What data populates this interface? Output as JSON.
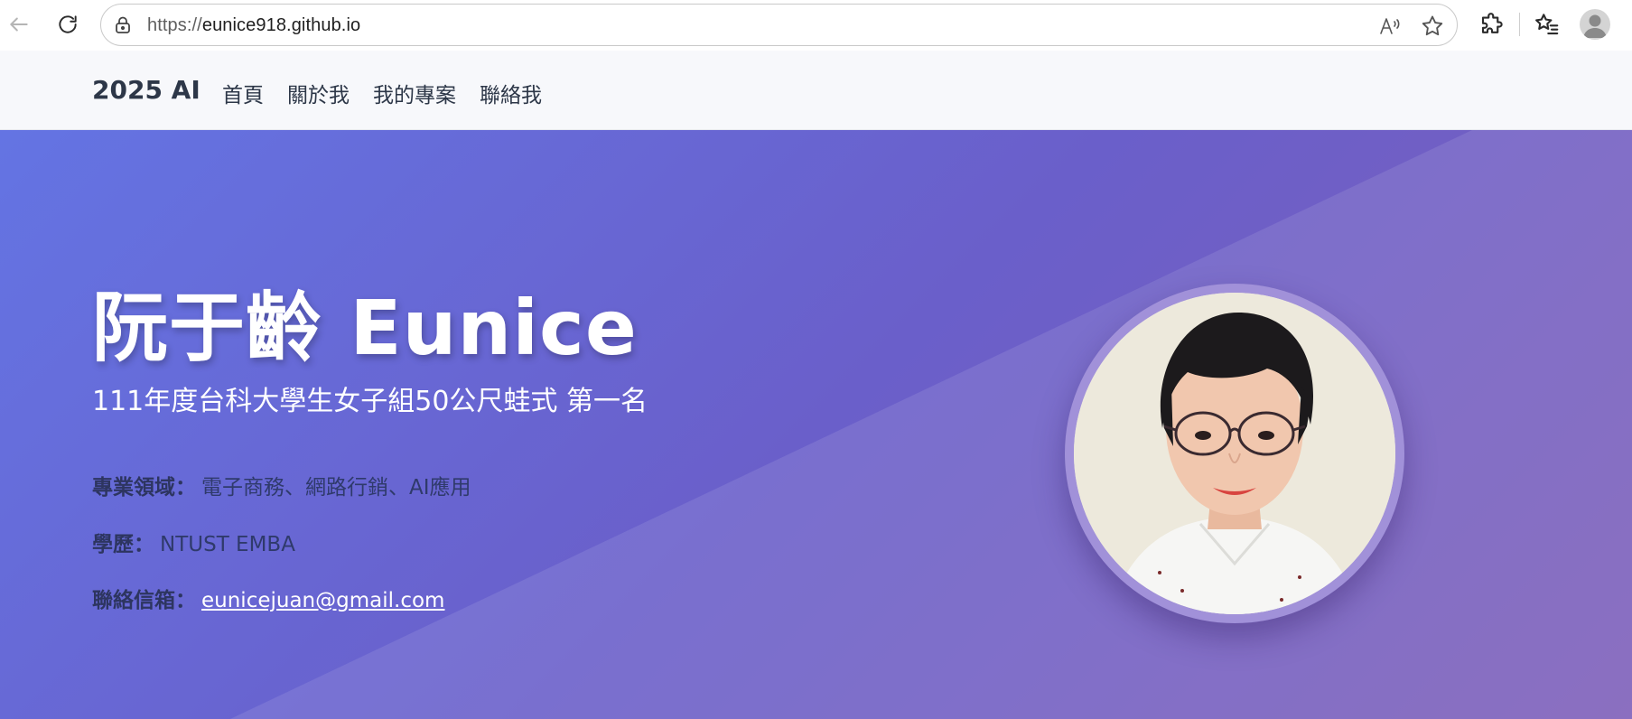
{
  "browser": {
    "url_prefix": "https://",
    "url_host": "eunice918.github.io",
    "icons": [
      "back-arrow-icon",
      "refresh-icon",
      "lock-icon",
      "read-aloud-icon",
      "favorite-star-icon",
      "extensions-icon",
      "favorites-list-icon",
      "profile-avatar-icon"
    ]
  },
  "site": {
    "brand": "2025 AI",
    "nav": [
      "首頁",
      "關於我",
      "我的專案",
      "聯絡我"
    ]
  },
  "hero": {
    "name": "阮于齡 Eunice",
    "subtitle": "111年度台科大學生女子組50公尺蛙式 第一名",
    "info": [
      {
        "label": "專業領域：",
        "value": "電子商務、網路行銷、AI應用"
      },
      {
        "label": "學歷：",
        "value": "NTUST EMBA"
      },
      {
        "label": "聯絡信箱：",
        "value": "eunicejuan@gmail.com"
      }
    ]
  },
  "colors": {
    "hero_gradient_start": "#6474e3",
    "hero_gradient_end": "#7e5fb9",
    "header_bg": "#f7f8fb",
    "text_dark": "#2d3748",
    "portrait_ring": "#a191d9"
  }
}
